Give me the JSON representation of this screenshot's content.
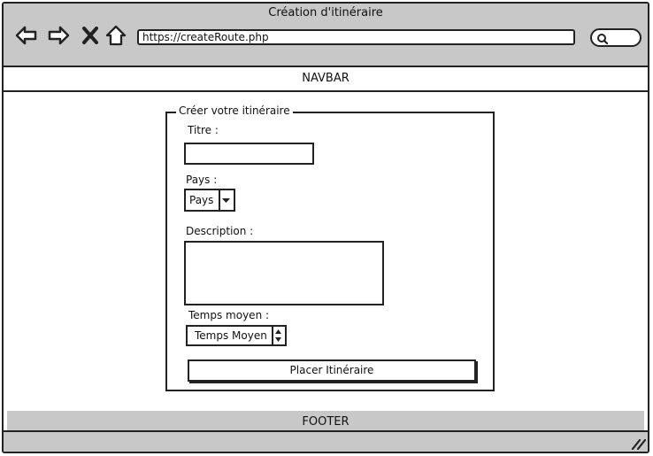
{
  "window": {
    "title": "Création d'itinéraire"
  },
  "toolbar": {
    "back_icon": "back-arrow-icon",
    "forward_icon": "forward-arrow-icon",
    "stop_icon": "close-icon",
    "home_icon": "home-icon",
    "url": "https://createRoute.php",
    "search_icon": "search-icon"
  },
  "navbar": {
    "label": "NAVBAR"
  },
  "form": {
    "legend": "Créer votre itinéraire",
    "title_label": "Titre :",
    "title_value": "",
    "country_label": "Pays :",
    "country_selected": "Pays",
    "description_label": "Description :",
    "description_value": "",
    "time_label": "Temps moyen :",
    "time_value": "Temps Moyen",
    "submit_label": "Placer Itinéraire"
  },
  "footer": {
    "label": "FOOTER"
  },
  "colors": {
    "chrome_gray": "#c8c8c8",
    "stroke": "#222222",
    "background": "#ffffff"
  }
}
